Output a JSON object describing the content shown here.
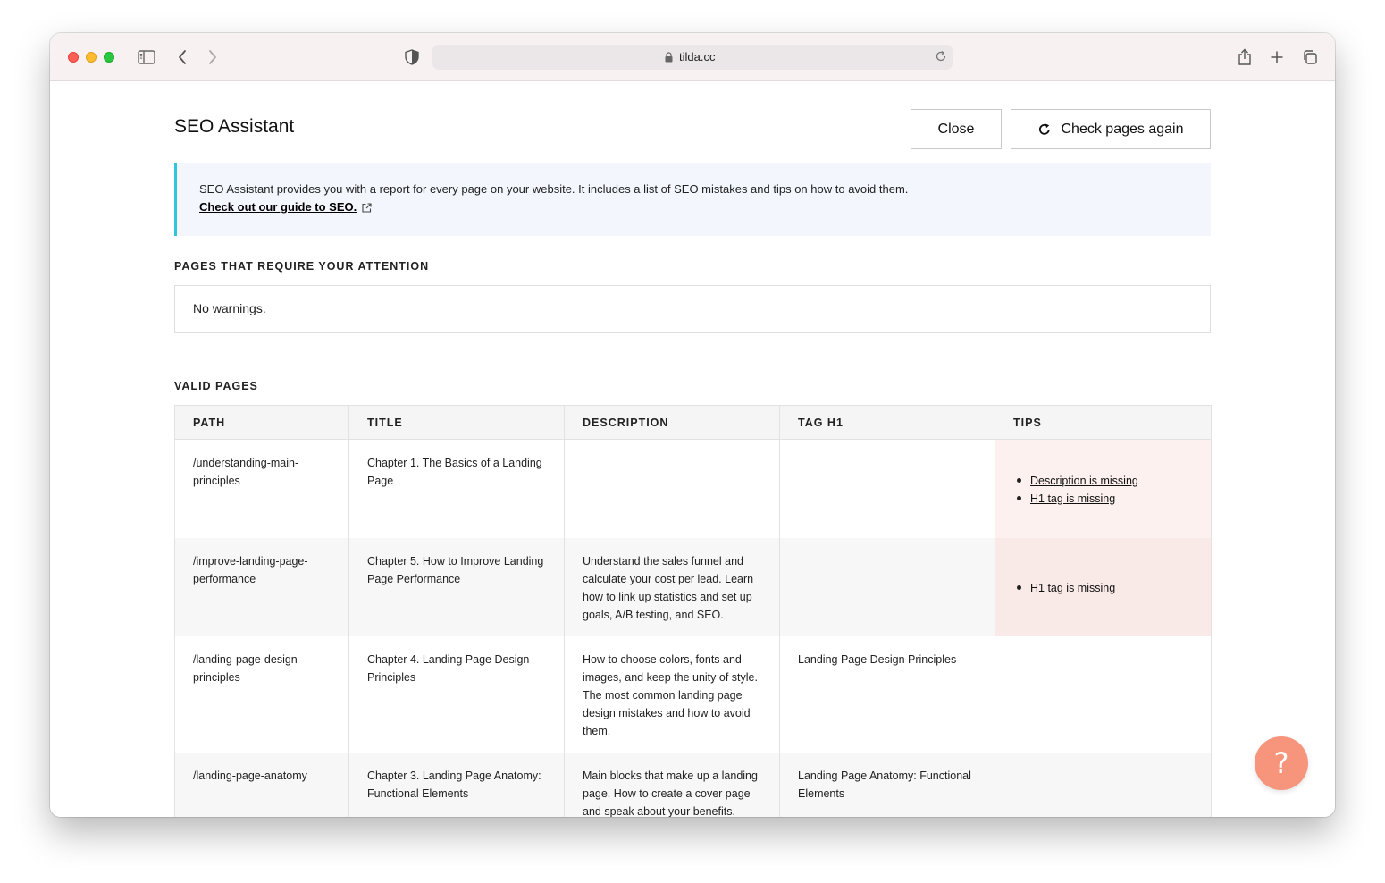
{
  "browser": {
    "url": "tilda.cc"
  },
  "header": {
    "title": "SEO Assistant",
    "close_label": "Close",
    "check_label": "Check pages again"
  },
  "info": {
    "text": "SEO Assistant provides you with a report for every page on your website. It includes a list of SEO mistakes and tips on how to avoid them.",
    "link": "Check out our guide to SEO."
  },
  "attention": {
    "label": "PAGES THAT REQUIRE YOUR ATTENTION",
    "message": "No warnings."
  },
  "valid": {
    "label": "VALID PAGES",
    "columns": [
      "PATH",
      "TITLE",
      "DESCRIPTION",
      "TAG H1",
      "TIPS"
    ],
    "rows": [
      {
        "path": "/understanding-main-principles",
        "title": "Chapter 1. The Basics of a Landing Page",
        "description": "",
        "h1": "",
        "tips": [
          "Description is missing",
          "H1 tag is missing"
        ]
      },
      {
        "path": "/improve-landing-page-performance",
        "title": "Chapter 5. How to Improve Landing Page Performance",
        "description": "Understand the sales funnel and calculate your cost per lead. Learn how to link up statistics and set up goals, A/B testing, and SEO.",
        "h1": "",
        "tips": [
          "H1 tag is missing"
        ]
      },
      {
        "path": "/landing-page-design-principles",
        "title": "Chapter 4. Landing Page Design Principles",
        "description": "How to choose colors, fonts and images, and keep the unity of style. The most common landing page design mistakes and how to avoid them.",
        "h1": "Landing Page Design Principles",
        "tips": []
      },
      {
        "path": "/landing-page-anatomy",
        "title": "Chapter 3. Landing Page Anatomy: Functional Elements",
        "description": "Main blocks that make up a landing page. How to create a cover page and speak about your benefits.",
        "h1": "Landing Page Anatomy: Functional Elements",
        "tips": []
      }
    ]
  },
  "help": {
    "label": "?"
  },
  "colors": {
    "accent": "#2ec6dd",
    "help_button": "#f7957c",
    "tips_bg": "#fdf1ef"
  }
}
